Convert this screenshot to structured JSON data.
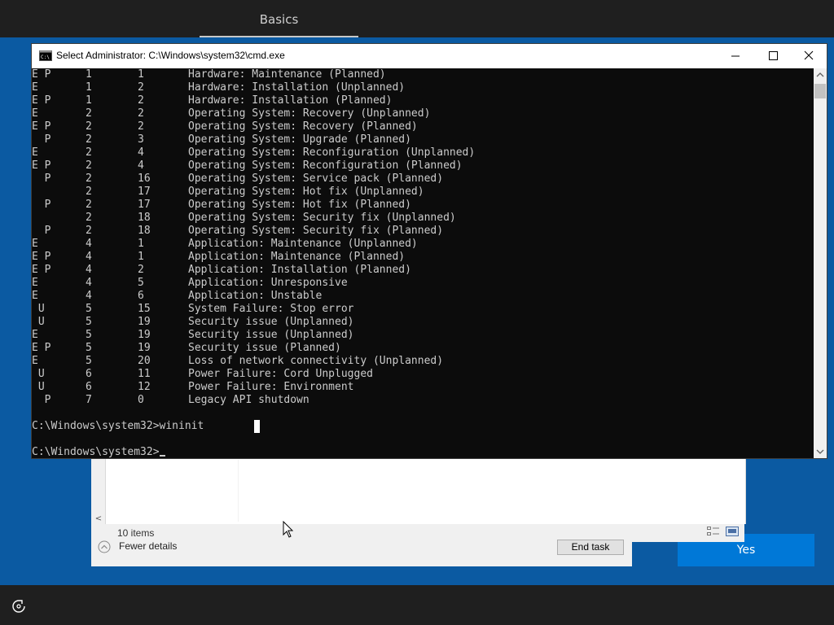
{
  "oobe": {
    "tab_label": "Basics",
    "yes_label": "Yes",
    "accessibility_icon": "ease-of-access-icon"
  },
  "task_manager": {
    "items_count": "10 items",
    "fewer_details_label": "Fewer details",
    "end_task_label": "End task"
  },
  "cmd": {
    "title": "Select Administrator: C:\\Windows\\system32\\cmd.exe",
    "rows": [
      {
        "flags": "E P",
        "major": "1",
        "minor": "1",
        "desc": "Hardware: Maintenance (Planned)"
      },
      {
        "flags": "E",
        "major": "1",
        "minor": "2",
        "desc": "Hardware: Installation (Unplanned)"
      },
      {
        "flags": "E P",
        "major": "1",
        "minor": "2",
        "desc": "Hardware: Installation (Planned)"
      },
      {
        "flags": "E",
        "major": "2",
        "minor": "2",
        "desc": "Operating System: Recovery (Unplanned)"
      },
      {
        "flags": "E P",
        "major": "2",
        "minor": "2",
        "desc": "Operating System: Recovery (Planned)"
      },
      {
        "flags": "  P",
        "major": "2",
        "minor": "3",
        "desc": "Operating System: Upgrade (Planned)"
      },
      {
        "flags": "E",
        "major": "2",
        "minor": "4",
        "desc": "Operating System: Reconfiguration (Unplanned)"
      },
      {
        "flags": "E P",
        "major": "2",
        "minor": "4",
        "desc": "Operating System: Reconfiguration (Planned)"
      },
      {
        "flags": "  P",
        "major": "2",
        "minor": "16",
        "desc": "Operating System: Service pack (Planned)"
      },
      {
        "flags": "",
        "major": "2",
        "minor": "17",
        "desc": "Operating System: Hot fix (Unplanned)"
      },
      {
        "flags": "  P",
        "major": "2",
        "minor": "17",
        "desc": "Operating System: Hot fix (Planned)"
      },
      {
        "flags": "",
        "major": "2",
        "minor": "18",
        "desc": "Operating System: Security fix (Unplanned)"
      },
      {
        "flags": "  P",
        "major": "2",
        "minor": "18",
        "desc": "Operating System: Security fix (Planned)"
      },
      {
        "flags": "E",
        "major": "4",
        "minor": "1",
        "desc": "Application: Maintenance (Unplanned)"
      },
      {
        "flags": "E P",
        "major": "4",
        "minor": "1",
        "desc": "Application: Maintenance (Planned)"
      },
      {
        "flags": "E P",
        "major": "4",
        "minor": "2",
        "desc": "Application: Installation (Planned)"
      },
      {
        "flags": "E",
        "major": "4",
        "minor": "5",
        "desc": "Application: Unresponsive"
      },
      {
        "flags": "E",
        "major": "4",
        "minor": "6",
        "desc": "Application: Unstable"
      },
      {
        "flags": " U",
        "major": "5",
        "minor": "15",
        "desc": "System Failure: Stop error"
      },
      {
        "flags": " U",
        "major": "5",
        "minor": "19",
        "desc": "Security issue (Unplanned)"
      },
      {
        "flags": "E",
        "major": "5",
        "minor": "19",
        "desc": "Security issue (Unplanned)"
      },
      {
        "flags": "E P",
        "major": "5",
        "minor": "19",
        "desc": "Security issue (Planned)"
      },
      {
        "flags": "E",
        "major": "5",
        "minor": "20",
        "desc": "Loss of network connectivity (Unplanned)"
      },
      {
        "flags": " U",
        "major": "6",
        "minor": "11",
        "desc": "Power Failure: Cord Unplugged"
      },
      {
        "flags": " U",
        "major": "6",
        "minor": "12",
        "desc": "Power Failure: Environment"
      },
      {
        "flags": "  P",
        "major": "7",
        "minor": "0",
        "desc": "Legacy API shutdown"
      }
    ],
    "command_line": "C:\\Windows\\system32>wininit",
    "prompt": "C:\\Windows\\system32>"
  }
}
